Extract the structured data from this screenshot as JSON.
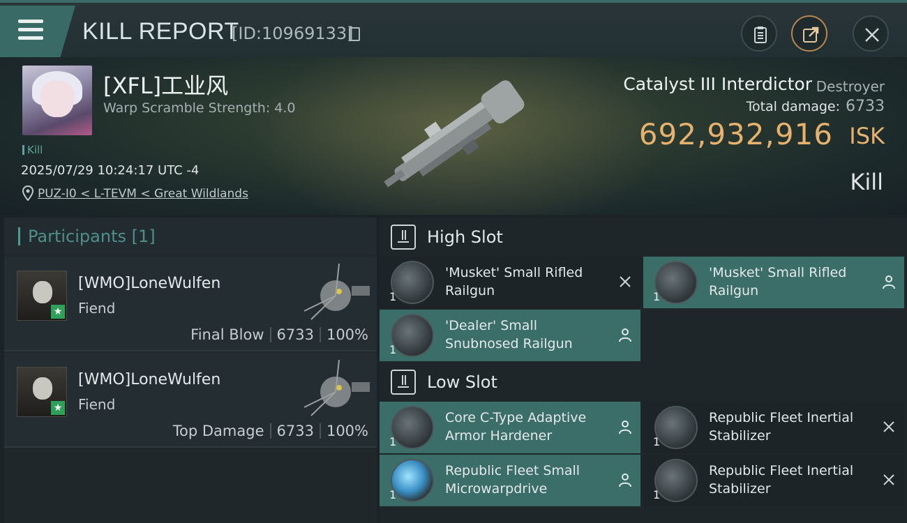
{
  "header": {
    "title": "KILL REPORT",
    "report_id": "[ID:10969133]"
  },
  "victim": {
    "name": "[XFL]工业风",
    "warp_scramble": "Warp Scramble Strength: 4.0",
    "kill_tag": "Kill",
    "datetime": "2025/07/29 10:24:17 UTC -4",
    "location": "PUZ-I0 < L-TEVM < Great Wildlands",
    "ship_name": "Catalyst III Interdictor",
    "ship_class": "Destroyer",
    "total_damage_label": "Total damage:",
    "total_damage": "6733",
    "isk_value": "692,932,916",
    "isk_unit": "ISK",
    "result": "Kill"
  },
  "participants": {
    "title": "Participants [1]",
    "cards": [
      {
        "name": "[WMO]LoneWulfen",
        "ship": "Fiend",
        "role": "Final Blow",
        "damage": "6733",
        "percent": "100%"
      },
      {
        "name": "[WMO]LoneWulfen",
        "ship": "Fiend",
        "role": "Top Damage",
        "damage": "6733",
        "percent": "100%"
      }
    ]
  },
  "fitting": {
    "high_slot_label": "High Slot",
    "low_slot_label": "Low Slot",
    "high": [
      {
        "name1": "'Musket' Small Rifled",
        "name2": "Railgun",
        "qty": "1",
        "state": "destroyed"
      },
      {
        "name1": "'Musket' Small Rifled",
        "name2": "Railgun",
        "qty": "1",
        "state": "dropped"
      },
      {
        "name1": "'Dealer' Small",
        "name2": "Snubnosed Railgun",
        "qty": "1",
        "state": "dropped"
      }
    ],
    "low": [
      {
        "name1": "Core C-Type Adaptive",
        "name2": " Armor Hardener",
        "qty": "1",
        "state": "dropped"
      },
      {
        "name1": "Republic Fleet Inertial",
        "name2": "Stabilizer",
        "qty": "1",
        "state": "destroyed"
      },
      {
        "name1": "Republic Fleet Small",
        "name2": "Microwarpdrive",
        "qty": "1",
        "state": "dropped"
      },
      {
        "name1": "Republic Fleet Inertial",
        "name2": "Stabilizer",
        "qty": "1",
        "state": "destroyed"
      }
    ]
  },
  "colors": {
    "accent": "#3b6e69",
    "isk": "#e7b26e"
  }
}
